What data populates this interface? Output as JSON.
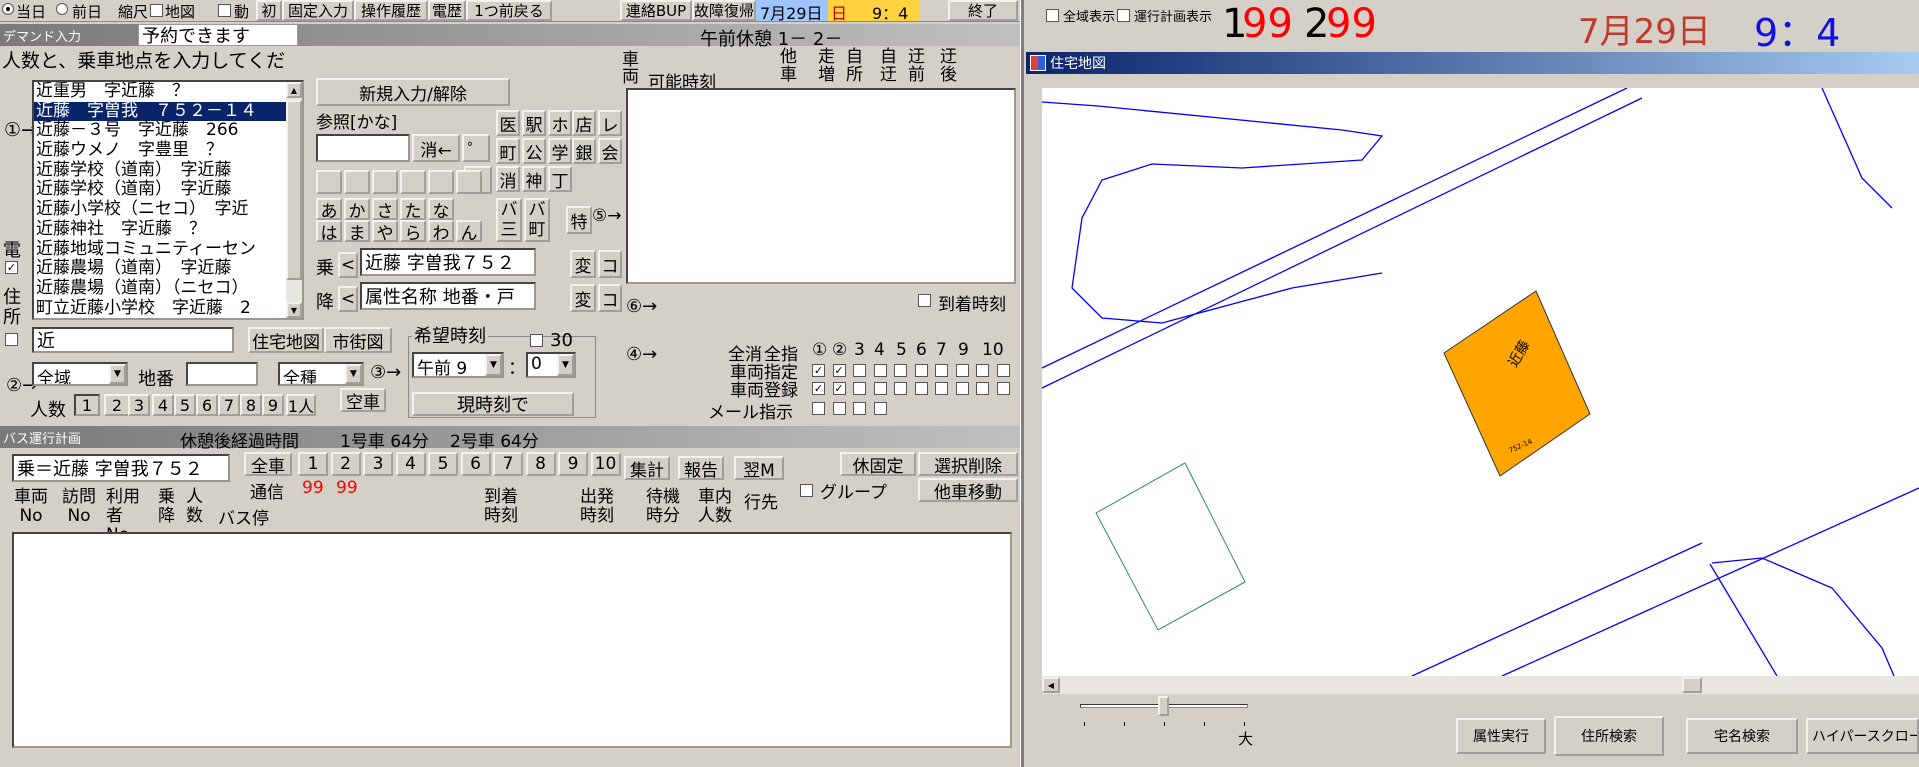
{
  "topbar": {
    "radio_today": "当日",
    "radio_prev": "前日",
    "shrink": "縮尺",
    "map": "地図",
    "move": "動",
    "init": "初",
    "fixed_input": "固定入力",
    "history": "操作履歴",
    "phone": "電歴",
    "back_one": "1つ前戻る",
    "contact_bup": "連絡BUP",
    "fault_recover": "故障復帰",
    "date": "7月29日",
    "weekday": "日",
    "time": "9：4",
    "quit": "終了"
  },
  "demand": {
    "title": "デマンド入力",
    "status": "予約できます",
    "rest": "午前休憩 1－ 2－",
    "instruction": "人数と、乗車地点を入力してくだ",
    "marker1": "①→",
    "marker2": "②→",
    "marker4": "④→",
    "marker5": "⑤→",
    "marker6": "⑥→",
    "elec_label": "電",
    "addr_label": "住所",
    "addr_value": "近",
    "results": [
      "近重男　字近藤　？",
      "近藤　字曽我　７５２－１４",
      "近藤－３号　字近藤　266",
      "近藤ウメノ　字豊里　？",
      "近藤学校（道南）　字近藤",
      "近藤学校（道南）　字近藤",
      "近藤小学校（ニセコ）　字近",
      "近藤神社　字近藤　？",
      "近藤地域コミュニティーセン",
      "近藤農場（道南）　字近藤",
      "近藤農場（道南）（ニセコ）",
      "町立近藤小学校　字近藤　2"
    ],
    "new_input": "新規入力/解除",
    "ref_kana": "参照[かな]",
    "erase": "消←",
    "dakuten": "゜",
    "handakuten": "゛",
    "fac": [
      "医",
      "駅",
      "ホ",
      "店",
      "レ",
      "町",
      "公",
      "学",
      "銀",
      "会",
      "消",
      "神",
      "丁"
    ],
    "kana_row1": [
      "あ",
      "か",
      "さ",
      "た",
      "な"
    ],
    "kana_row2": [
      "は",
      "ま",
      "や",
      "ら",
      "わ",
      "ん"
    ],
    "ba1": "バ",
    "ba2": "バ",
    "mi": "三",
    "machi": "町",
    "toku": "特",
    "board_label": "乗",
    "alight_label": "降",
    "board_value": "近藤 字曽我７５２",
    "alight_value": "属性名称 地番・戸",
    "chg1": "変",
    "chg2": "変",
    "ko1": "コ",
    "ko2": "コ",
    "prev_arrow": "<",
    "houses_map": "住宅地図",
    "city_map": "市街図",
    "area": "全域",
    "lot_label": "地番",
    "kind": "全種",
    "pax_label": "人数",
    "pax": [
      "1",
      "2",
      "3",
      "4",
      "5",
      "6",
      "7",
      "8",
      "9",
      "1人"
    ],
    "empty_car": "空車",
    "wish_time": "希望時刻",
    "min30": "30",
    "ampm": "午前",
    "hour": "9",
    "colon": "：",
    "minute": "0",
    "now": "現時刻で",
    "marker3": "③→",
    "vehicle_hdr": "車両",
    "possible_time": "可能時刻",
    "col_other": "他車",
    "col_run": "走増",
    "col_self": "自所",
    "col_detour": "自迂",
    "col_pre": "迂前",
    "col_post": "迂後",
    "arrival_time": "到着時刻",
    "all_clear": "全消",
    "all_assign": "全指",
    "car_assign": "車両指定",
    "car_reg": "車両登録",
    "mail": "メール指示",
    "car_nums": [
      "①",
      "②",
      "3",
      "4",
      "5",
      "6",
      "7",
      "9",
      "10"
    ]
  },
  "bus": {
    "title": "バス運行計画",
    "elapsed": "休憩後経過時間",
    "car1": "1号車 64分",
    "car2": "2号車 64分",
    "board_field": "乗＝近藤 字曽我７５２",
    "all_cars": "全車",
    "nums": [
      "1",
      "2",
      "3",
      "4",
      "5",
      "6",
      "7",
      "8",
      "9",
      "10"
    ],
    "summary": "集計",
    "report": "報告",
    "next_m": "翌M",
    "comm": "通信",
    "comm_a": "99",
    "comm_b": "99",
    "rest_fix": "休固定",
    "del_sel": "選択削除",
    "group": "グループ",
    "move_car": "他車移動",
    "cols": {
      "car": "車両No",
      "visit": "訪問No",
      "user": "利用者No",
      "board": "乗降",
      "pax": "人数",
      "stop": "バス停",
      "arrive": "到着時刻",
      "depart": "出発時刻",
      "wait": "待機時分",
      "inside": "車内人数",
      "dest": "行先"
    }
  },
  "map": {
    "show_all": "全域表示",
    "show_plan": "運行計画表示",
    "c1_a": "1",
    "c1_b": "99",
    "c2_a": "2",
    "c2_b": "99",
    "date": "7月29日",
    "time": "9：4",
    "title": "住宅地図",
    "house_label": "近藤",
    "house_sub": "752-14",
    "zoom_label": "大",
    "attr_exec": "属性実行",
    "addr_search": "住所検索",
    "house_search": "宅名検索",
    "hyper_scroll": "ハイパースクロール",
    "colors": {
      "road": "#0000ff",
      "house": "#ffa500",
      "accent_red": "#ff0000",
      "date_red": "#c0392b",
      "time_blue": "#1010e0"
    }
  }
}
